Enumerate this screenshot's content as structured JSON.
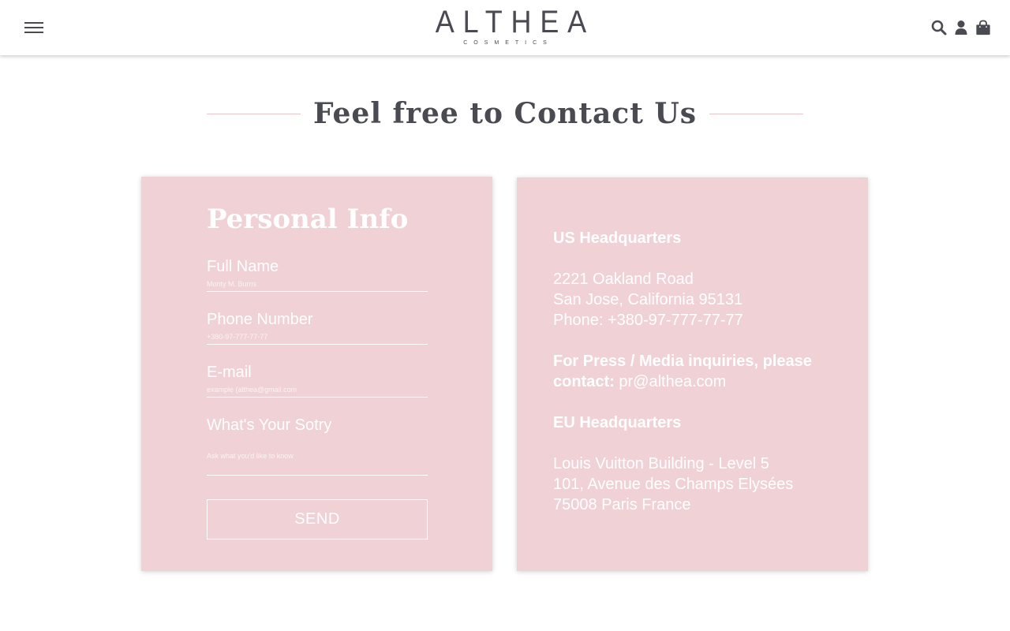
{
  "header": {
    "logo_main": "ALTHEA",
    "logo_sub": "COSMETICS",
    "icons": [
      "menu-icon",
      "search-icon",
      "user-icon",
      "bag-icon"
    ]
  },
  "page_title": "Feel free to Contact Us",
  "form": {
    "heading": "Personal Info",
    "fields": [
      {
        "label": "Full Name",
        "placeholder": "Monty M. Burns"
      },
      {
        "label": "Phone Number",
        "placeholder": "+380-97-777-77-77"
      },
      {
        "label": "E-mail",
        "placeholder": "example (althea@gmail.com"
      },
      {
        "label": "What's Your Sotry",
        "placeholder": "Ask what you'd like to know"
      }
    ],
    "send_label": "SEND"
  },
  "info": {
    "us_heading": "US Headquarters",
    "us_address_1": "2221 Oakland Road",
    "us_address_2": "San Jose, California 95131",
    "us_phone": "Phone: +380-97-777-77-77",
    "press_text": "For Press / Media inquiries, please contact:",
    "press_email": "pr@althea.com",
    "eu_heading": "EU Headquarters",
    "eu_address_1": "Louis Vuitton Building - Level 5",
    "eu_address_2": "101, Avenue des Champs Elysées",
    "eu_address_3": "75008 Paris France"
  },
  "colors": {
    "card_bg": "#f0d1d5",
    "text_dark": "#4a4a52",
    "title_line": "#eac5c9"
  }
}
